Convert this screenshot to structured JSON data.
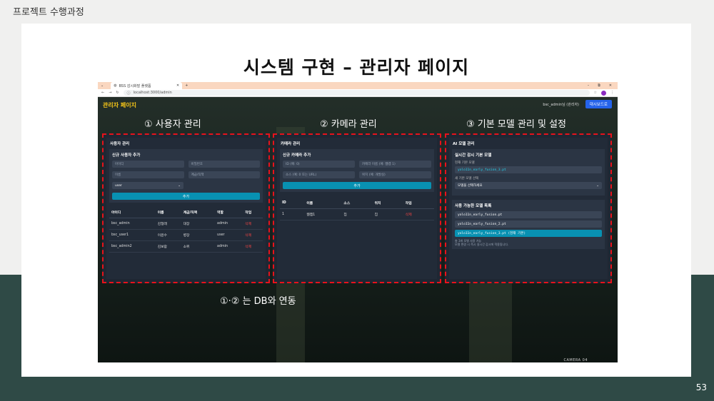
{
  "slide": {
    "section_label": "프로젝트 수행과정",
    "title": "시스템 구현 – 관리자 페이지",
    "page_number": "53"
  },
  "browser": {
    "tab_title": "BSS 감시화말 플랫폼",
    "url": "localhost:3000/admin",
    "win_minimize": "–",
    "win_restore": "⧉",
    "win_close": "✕"
  },
  "app": {
    "title": "관리자 페이지",
    "current_user": "bsc_admin님 (관리자)",
    "dashboard_button": "대시보드로",
    "camera_overlay": "CAMERA 04"
  },
  "annotations": {
    "users": "① 사용자 관리",
    "cameras": "② 카메라 관리",
    "models": "③ 기본 모델 관리 및 설정",
    "db_link": "①·② 는 DB와 연동"
  },
  "user_panel": {
    "header": "사용자 관리",
    "form_title": "신규 사용자 추가",
    "placeholders": {
      "id": "아이디",
      "password": "비밀번호",
      "name": "이름",
      "rank": "계급/직책"
    },
    "role_select": "user",
    "add_button": "추가",
    "columns": [
      "아이디",
      "이름",
      "계급/직책",
      "역할",
      "작업"
    ],
    "rows": [
      {
        "id": "bsc_admin",
        "name": "김형래",
        "rank": "대장",
        "role": "admin",
        "action": "삭제"
      },
      {
        "id": "bsc_user1",
        "name": "이윤수",
        "rank": "병장",
        "role": "user",
        "action": "삭제"
      },
      {
        "id": "bsc_admin2",
        "name": "김보람",
        "rank": "소위",
        "role": "admin",
        "action": "삭제"
      }
    ]
  },
  "camera_panel": {
    "header": "카메라 관리",
    "form_title": "신규 카메라 추가",
    "placeholders": {
      "id": "ID (예: 0)",
      "name": "카메라 이름 (예: 웹캠 1)",
      "source": "소스 (예: 0 또는 URL)",
      "location": "위치 (예: 개발실)"
    },
    "add_button": "추가",
    "columns": [
      "ID",
      "이름",
      "소스",
      "위치",
      "작업"
    ],
    "rows": [
      {
        "id": "1",
        "name": "웹캠1",
        "source": "집",
        "location": "집",
        "action": "삭제"
      }
    ]
  },
  "model_panel": {
    "header": "AI 모델 관리",
    "realtime_title": "실시간 감시 기본 모델",
    "current_label": "현재 기본 모델",
    "current_model": "yolo11n_early_fusion_3.pt",
    "new_label": "새 기본 모델 선택",
    "select_placeholder": "모델을 선택하세요",
    "available_title": "사용 가능한 모델 목록",
    "models": [
      {
        "name": "yolo11n_early_fusion.pt"
      },
      {
        "name": "yolo11n_early_fusion_2.pt"
      },
      {
        "name": "yolo11n_early_fusion_3.pt (현재 기본)"
      }
    ],
    "note1": "총 3개 모델 사용 가능",
    "note2": "모델 변경 시 즉시 실시간 감시에 적용됩니다."
  }
}
